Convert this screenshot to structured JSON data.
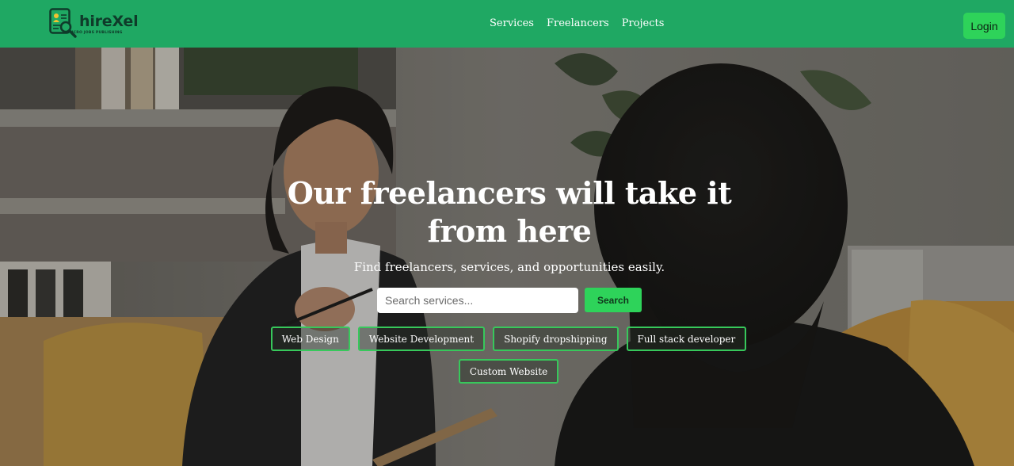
{
  "brand": {
    "name": "hireXel",
    "tagline": "MICRO JOBS PUBLISHING",
    "icon": "search-document-icon",
    "colors": {
      "header": "#1fa863",
      "accent": "#2ed35a",
      "logo_text": "#0f3b2a"
    }
  },
  "nav": {
    "items": [
      {
        "label": "Services"
      },
      {
        "label": "Freelancers"
      },
      {
        "label": "Projects"
      }
    ],
    "login_label": "Login"
  },
  "hero": {
    "title": "Our freelancers will take it from here",
    "subtitle": "Find freelancers, services, and opportunities easily.",
    "search": {
      "placeholder": "Search services...",
      "value": "",
      "button_label": "Search"
    },
    "tags": [
      {
        "label": "Web Design"
      },
      {
        "label": "Website Development"
      },
      {
        "label": "Shopify dropshipping"
      },
      {
        "label": "Full stack developer"
      },
      {
        "label": "Custom Website"
      }
    ]
  }
}
